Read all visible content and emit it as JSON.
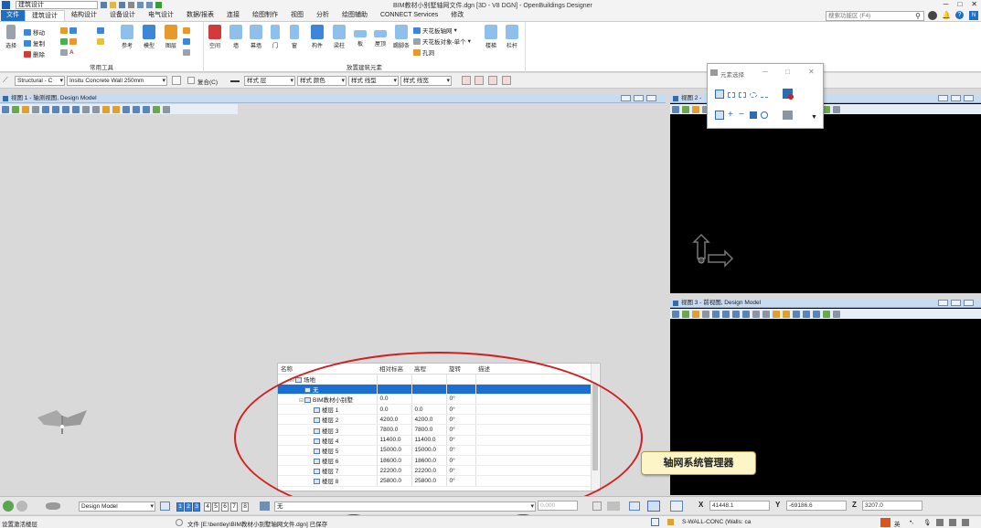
{
  "titlebar": {
    "workspace": "建筑设计",
    "title": "BIM教材小别墅轴网文件.dgn [3D - V8 DGN] - OpenBuildings Designer",
    "window_buttons": [
      "─",
      "□",
      "✕"
    ]
  },
  "ribbon_tabs": [
    "文件",
    "建筑设计",
    "结构设计",
    "设备设计",
    "电气设计",
    "数据/报表",
    "连接",
    "绘图制作",
    "视图",
    "分析",
    "绘图辅助",
    "CONNECT Services",
    "修改"
  ],
  "search": {
    "placeholder": "搜索功能区 (F4)"
  },
  "ribbon": {
    "common_tools": {
      "label": "常用工具",
      "select": "选择",
      "move": "移动",
      "copy": "复制",
      "delete": "删除",
      "reference": "参考",
      "model": "模型",
      "level": "图层"
    },
    "place_building": {
      "label": "放置建筑元素",
      "space": "空间",
      "wall": "墙",
      "curtain": "幕墙",
      "door": "门",
      "window": "窗",
      "component": "构件",
      "column": "梁柱",
      "slab": "板",
      "roof": "屋顶",
      "skirting": "踢脚条",
      "ceiling_grid": "天花板轴网",
      "ceiling_object": "天花板对象-单个",
      "opening": "孔洞",
      "stair": "楼梯",
      "railing": "栏杆"
    }
  },
  "attributes": {
    "catalog": "Structural - C",
    "family": "Insitu Concrete Wall 250mm",
    "composite": "复合(C)",
    "level_style": "样式 层",
    "color_style": "样式 颜色",
    "weight_style": "样式 线型",
    "line_style": "样式 线宽"
  },
  "views": [
    {
      "title": "视图 1 - 轴测视图, Design Model"
    },
    {
      "title": "视图 2 - "
    },
    {
      "title": "视图 3 - 前视图, Design Model"
    }
  ],
  "element_selection": {
    "title": "元素选择"
  },
  "grid_manager": {
    "columns": [
      "名称",
      "相对标高",
      "高程",
      "旋转",
      "描述"
    ],
    "rows": [
      {
        "name": "场地",
        "rel": "",
        "elev": "",
        "rot": "",
        "indent": 1,
        "expand": "⊟"
      },
      {
        "name": "无",
        "rel": "",
        "elev": "",
        "rot": "",
        "indent": 2,
        "expand": "",
        "selected": true
      },
      {
        "name": "BIM教材小别墅",
        "rel": "0.0",
        "elev": "",
        "rot": "0°",
        "indent": 2,
        "expand": "⊟"
      },
      {
        "name": "楼层 1",
        "rel": "0.0",
        "elev": "0.0",
        "rot": "0°",
        "indent": 3,
        "expand": ""
      },
      {
        "name": "楼层 2",
        "rel": "4200.0",
        "elev": "4200.0",
        "rot": "0°",
        "indent": 3,
        "expand": ""
      },
      {
        "name": "楼层 3",
        "rel": "7800.0",
        "elev": "7800.0",
        "rot": "0°",
        "indent": 3,
        "expand": ""
      },
      {
        "name": "楼层 4",
        "rel": "11400.0",
        "elev": "11400.0",
        "rot": "0°",
        "indent": 3,
        "expand": ""
      },
      {
        "name": "楼层 5",
        "rel": "15000.0",
        "elev": "15000.0",
        "rot": "0°",
        "indent": 3,
        "expand": ""
      },
      {
        "name": "楼层 6",
        "rel": "18600.0",
        "elev": "18600.0",
        "rot": "0°",
        "indent": 3,
        "expand": ""
      },
      {
        "name": "楼层 7",
        "rel": "22200.0",
        "elev": "22200.0",
        "rot": "0°",
        "indent": 3,
        "expand": ""
      },
      {
        "name": "楼层 8",
        "rel": "25800.0",
        "elev": "25800.0",
        "rot": "0°",
        "indent": 3,
        "expand": ""
      }
    ]
  },
  "callout": {
    "text": "轴网系统管理器"
  },
  "bottombar": {
    "model": "Design Model",
    "view_numbers": [
      "1",
      "2",
      "3",
      "4",
      "5",
      "6",
      "7",
      "8"
    ],
    "floor_value": "无",
    "dist_value": "0.000",
    "x_label": "X",
    "x_value": "41448.1",
    "y_label": "Y",
    "y_value": "-69186.6",
    "z_label": "Z",
    "z_value": "3207.0"
  },
  "statusbar": {
    "prompt": "设置激活楼层",
    "file_status": "文件 [E:\\bentley\\BIM教材小别墅轴网文件.dgn] 已保存",
    "active_level": "S-WALL-CONC (Walls: ca",
    "ime": "英"
  }
}
